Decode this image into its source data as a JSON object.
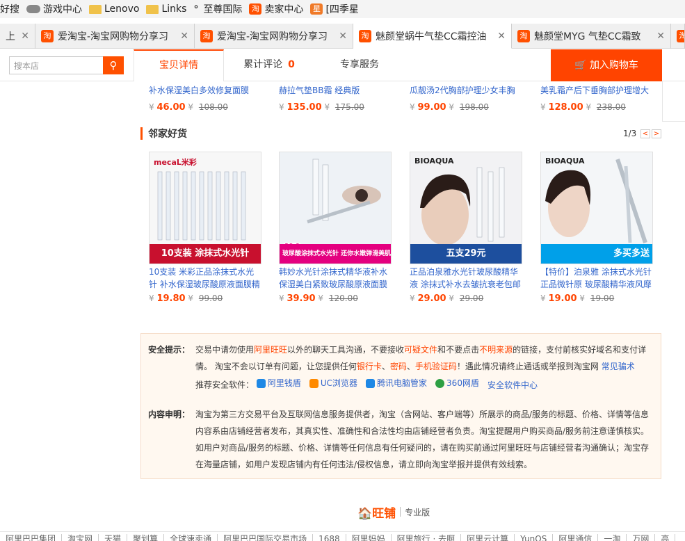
{
  "bookmarks": [
    {
      "label": "好搜",
      "icon": "none"
    },
    {
      "label": "游戏中心",
      "icon": "gamepad-icon"
    },
    {
      "label": "Lenovo",
      "icon": "folder-icon"
    },
    {
      "label": "Links",
      "icon": "folder-icon"
    },
    {
      "label": "至尊国际",
      "icon": "dot-icon"
    },
    {
      "label": "卖家中心",
      "icon": "taobao-icon"
    },
    {
      "label": "[四季星",
      "icon": "star-icon"
    }
  ],
  "tabs": [
    {
      "title": "上网",
      "active": false
    },
    {
      "title": "爱淘宝-淘宝网购物分享习",
      "active": false
    },
    {
      "title": "爱淘宝-淘宝网购物分享习",
      "active": false
    },
    {
      "title": "魅颜堂蜗牛气垫CC霜控油",
      "active": true
    },
    {
      "title": "魅颜堂MYG 气垫CC霜致",
      "active": false
    }
  ],
  "shop": {
    "search_placeholder": "搜本店",
    "tab_detail": "宝贝详情",
    "tab_reviews": "累计评论",
    "reviews_count": "0",
    "tab_service": "专享服务",
    "add_to_cart": "加入购物车"
  },
  "prev_row": [
    {
      "title": "补水保湿美白多效修复面膜",
      "price": "46.00",
      "old": "108.00"
    },
    {
      "title": "赫拉气垫BB霜 经典版",
      "price": "135.00",
      "old": "175.00"
    },
    {
      "title": "瓜靓汤2代胸部护理少女丰胸",
      "price": "99.00",
      "old": "198.00"
    },
    {
      "title": "美乳霜产后下垂胸部护理增大",
      "price": "128.00",
      "old": "238.00"
    }
  ],
  "section": {
    "title": "邻家好货",
    "page": "1/3",
    "prev": "<",
    "next": ">"
  },
  "products": [
    {
      "title": "10支装 米彩正品涂抹式水光针 补水保湿玻尿酸原液面膜精",
      "price": "19.80",
      "old": "99.00",
      "brand": "mecaL米彩",
      "banner": "10支装   涂抹式水光针",
      "accent": "#c8102e"
    },
    {
      "title": "韩妙水光针涂抹式精华液补水保湿美白紧致玻尿酸原液面膜",
      "price": "39.90",
      "old": "120.00",
      "banner": "玻尿酸涂抹式水光针 还你水嫩弹滑美肌",
      "badge": "39.9",
      "accent": "#e4007f"
    },
    {
      "title": "正品泊泉雅水光针玻尿酸精华液 涂抹式补水去皱抗衰老包邮",
      "price": "29.00",
      "old": "29.00",
      "brand": "BIOAQUA",
      "banner": "五支29元",
      "accent": "#1d4f9e"
    },
    {
      "title": "【特价】泊泉雅 涂抹式水光针正品微针原 玻尿酸精华液风靡",
      "price": "19.00",
      "old": "19.00",
      "brand": "BIOAQUA",
      "banner": "多买多送",
      "badge": "买1送1 买2送2",
      "accent": "#00a0e9"
    }
  ],
  "notice": {
    "safety_label": "安全提示：",
    "safety_1": "交易中请勿使用",
    "safety_ww": "阿里旺旺",
    "safety_2": "以外的聊天工具沟通，不要接收",
    "safety_file": "可疑文件",
    "safety_3": "和不要点击",
    "safety_src": "不明来源",
    "safety_4": "的链接，支付前核实好域名和支付详情。 淘宝不会以订单有问题，让您提供任何",
    "safety_bank": "银行卡",
    "safety_5": "、",
    "safety_pwd": "密码",
    "safety_6": "、",
    "safety_sms": "手机验证码",
    "safety_7": "！遇此情况请终止通话或举报到淘宝网 ",
    "safety_link": "常见骗术",
    "software_label": "推荐安全软件：",
    "software": [
      "阿里钱盾",
      "UC浏览器",
      "腾讯电脑管家",
      "360网盾",
      "安全软件中心"
    ],
    "content_label": "内容申明：",
    "content": "淘宝为第三方交易平台及互联网信息服务提供者，淘宝（含网站、客户端等）所展示的商品/服务的标题、价格、详情等信息内容系由店铺经营者发布，其真实性、准确性和合法性均由店铺经营者负责。淘宝提醒用户购买商品/服务前注意谨慎核实。如用户对商品/服务的标题、价格、详情等任何信息有任何疑问的，请在购买前通过阿里旺旺与店铺经营者沟通确认；淘宝存在海量店铺，如用户发现店铺内有任何违法/侵权信息，请立即向淘宝举报并提供有效线索。"
  },
  "brand": {
    "logo": "旺铺",
    "edition": "专业版"
  },
  "footer": [
    "阿里巴巴集团",
    "淘宝网",
    "天猫",
    "聚划算",
    "全球速卖通",
    "阿里巴巴国际交易市场",
    "1688",
    "阿里妈妈",
    "阿里旅行 · 去啊",
    "阿里云计算",
    "YunOS",
    "阿里通信",
    "一淘",
    "万网",
    "高"
  ]
}
